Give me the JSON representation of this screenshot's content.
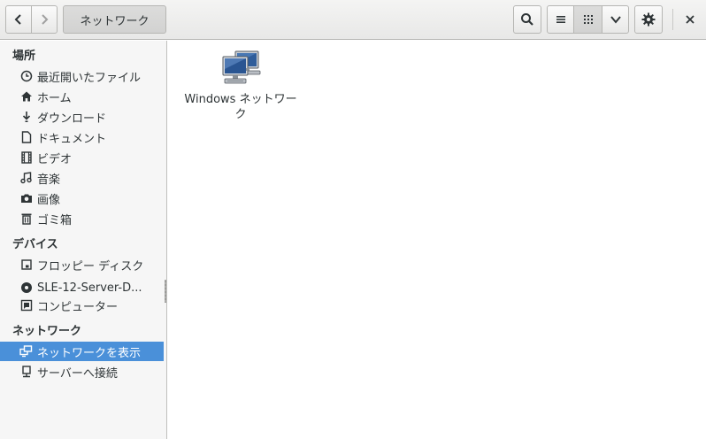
{
  "header": {
    "path_label": "ネットワーク"
  },
  "sidebar": {
    "places_title": "場所",
    "places": [
      {
        "label": "最近開いたファイル",
        "icon": "clock-icon"
      },
      {
        "label": "ホーム",
        "icon": "home-icon"
      },
      {
        "label": "ダウンロード",
        "icon": "download-icon"
      },
      {
        "label": "ドキュメント",
        "icon": "document-icon"
      },
      {
        "label": "ビデオ",
        "icon": "film-icon"
      },
      {
        "label": "音楽",
        "icon": "music-icon"
      },
      {
        "label": "画像",
        "icon": "camera-icon"
      },
      {
        "label": "ゴミ箱",
        "icon": "trash-icon"
      }
    ],
    "devices_title": "デバイス",
    "devices": [
      {
        "label": "フロッピー ディスク",
        "icon": "floppy-icon"
      },
      {
        "label": "SLE-12-Server-D...",
        "icon": "disc-icon"
      },
      {
        "label": "コンピューター",
        "icon": "computer-icon"
      }
    ],
    "network_title": "ネットワーク",
    "network": [
      {
        "label": "ネットワークを表示",
        "icon": "network-icon",
        "selected": true
      },
      {
        "label": "サーバーへ接続",
        "icon": "server-icon"
      }
    ]
  },
  "main": {
    "items": [
      {
        "label": "Windows ネットワーク",
        "icon": "windows-network-icon"
      }
    ]
  },
  "colors": {
    "accent": "#4a90d9"
  }
}
